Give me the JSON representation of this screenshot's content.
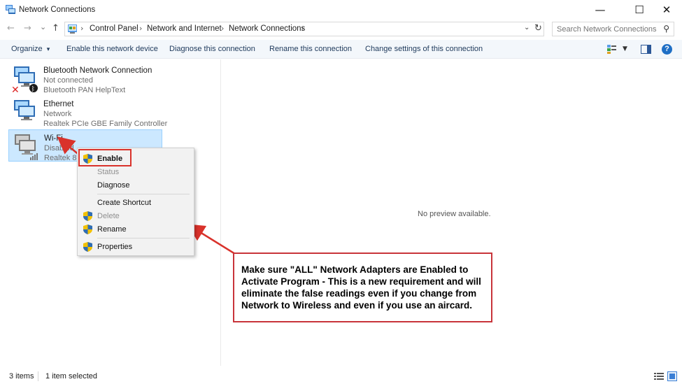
{
  "window": {
    "title": "Network Connections",
    "minimize_glyph": "—",
    "maximize_glyph": "☐",
    "close_glyph": "✕"
  },
  "nav": {
    "back_glyph": "←",
    "forward_glyph": "→",
    "recent_glyph": "⌄",
    "up_glyph": "↑"
  },
  "address": {
    "breadcrumbs": [
      "Control Panel",
      "Network and Internet",
      "Network Connections"
    ],
    "separator": "›",
    "dropdown_glyph": "⌄",
    "refresh_glyph": "↻"
  },
  "search": {
    "placeholder": "Search Network Connections",
    "icon": "search-icon"
  },
  "commands": {
    "organize": "Organize",
    "organize_arrow": "▾",
    "enable_device": "Enable this network device",
    "diagnose": "Diagnose this connection",
    "rename": "Rename this connection",
    "change_settings": "Change settings of this connection",
    "help": "?"
  },
  "connections": [
    {
      "name": "Bluetooth Network Connection",
      "status": "Not connected",
      "device": "Bluetooth PAN HelpText",
      "icon": "network-computer-icon"
    },
    {
      "name": "Ethernet",
      "status": "Network",
      "device": "Realtek PCIe GBE Family Controller",
      "icon": "network-computer-icon"
    },
    {
      "name": "Wi-Fi",
      "status": "Disabled",
      "device": "Realtek 88",
      "icon": "wifi-computer-icon"
    }
  ],
  "context_menu": {
    "items": [
      {
        "label": "Enable",
        "shield": true,
        "disabled": false,
        "bold": true
      },
      {
        "label": "Status",
        "shield": false,
        "disabled": true,
        "bold": false
      },
      {
        "label": "Diagnose",
        "shield": false,
        "disabled": false,
        "bold": false
      },
      {
        "label": "Create Shortcut",
        "shield": false,
        "disabled": false,
        "bold": false
      },
      {
        "label": "Delete",
        "shield": true,
        "disabled": true,
        "bold": false
      },
      {
        "label": "Rename",
        "shield": true,
        "disabled": false,
        "bold": false
      },
      {
        "label": "Properties",
        "shield": true,
        "disabled": false,
        "bold": false
      }
    ]
  },
  "preview": {
    "text": "No preview available."
  },
  "callout": {
    "text": "Make sure \"ALL\" Network Adapters are Enabled to Activate Program - This is a new requirement and will eliminate the false readings even if you change from Network to Wireless and even if you use an aircard."
  },
  "status_bar": {
    "items_count": "3 items",
    "selected": "1 item selected"
  },
  "colors": {
    "accent": "#1f6fc5",
    "command_text": "#1e395b",
    "selection_bg": "#cce8ff",
    "selection_border": "#99d1ff",
    "annotation_red": "#d9322b",
    "disabled_text": "#8f8f8f"
  }
}
